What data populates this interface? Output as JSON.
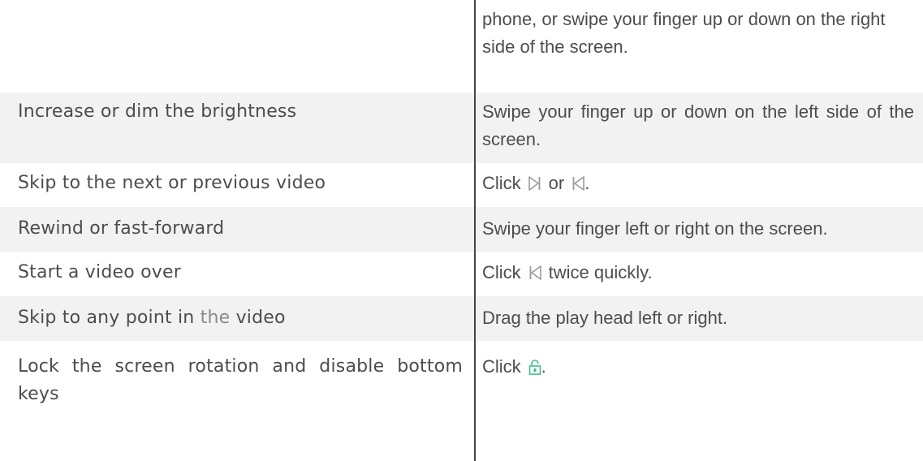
{
  "rows": [
    {
      "action": "",
      "description": "phone, or swipe your finger up or down on the right side of the screen."
    },
    {
      "action": "Increase or dim the brightness",
      "description": "Swipe your finger up or down on the left side of the screen."
    },
    {
      "action": "Skip to the next or previous video",
      "desc_prefix": "Click",
      "desc_middle": "or",
      "desc_suffix": "."
    },
    {
      "action": "Rewind or fast-forward",
      "description": "Swipe your finger left or right on the screen."
    },
    {
      "action": "Start a video over",
      "desc_prefix": "Click",
      "desc_suffix": "twice quickly."
    },
    {
      "action_prefix": "Skip to any point in",
      "action_the": "the",
      "action_suffix": "video",
      "description": "Drag the play head left or right."
    },
    {
      "action": "Lock the screen rotation and disable bottom keys",
      "desc_prefix": "Click",
      "desc_suffix": "."
    }
  ],
  "icons": {
    "next": "skip-next-icon",
    "previous": "skip-previous-icon",
    "lock": "lock-icon",
    "lock_color": "#3cc08a",
    "skip_color": "#9a9a9a"
  },
  "colors": {
    "row_shade": "#f2f2f2",
    "divider": "#444444",
    "text": "#4d4d4d"
  }
}
